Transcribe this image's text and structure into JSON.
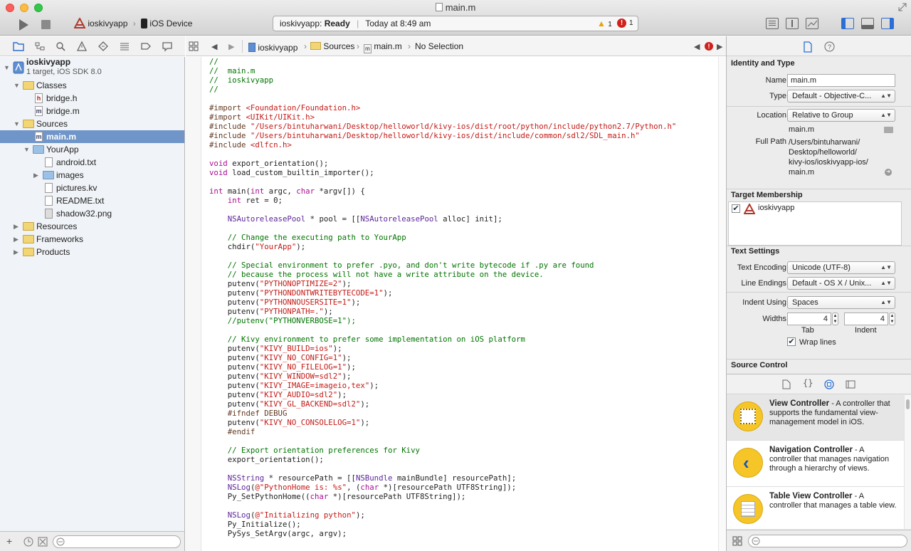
{
  "window": {
    "title": "main.m"
  },
  "toolbar": {
    "scheme": "ioskivyapp",
    "destination": "iOS Device",
    "status_app": "ioskivyapp:",
    "status_state": "Ready",
    "status_time": "Today at 8:49 am",
    "warning_count": "1",
    "error_count": "1"
  },
  "navigator": {
    "project_name": "ioskivyapp",
    "project_subtitle": "1 target, iOS SDK 8.0",
    "rows": [
      {
        "label": "Classes"
      },
      {
        "label": "bridge.h"
      },
      {
        "label": "bridge.m"
      },
      {
        "label": "Sources"
      },
      {
        "label": "main.m"
      },
      {
        "label": "YourApp"
      },
      {
        "label": "android.txt"
      },
      {
        "label": "images"
      },
      {
        "label": "pictures.kv"
      },
      {
        "label": "README.txt"
      },
      {
        "label": "shadow32.png"
      },
      {
        "label": "Resources"
      },
      {
        "label": "Frameworks"
      },
      {
        "label": "Products"
      }
    ]
  },
  "jumpbar": {
    "project": "ioskivyapp",
    "group": "Sources",
    "file": "main.m",
    "selection": "No Selection"
  },
  "code_lines": [
    "//",
    "//  main.m",
    "//  ioskivyapp",
    "//",
    "",
    "#import <Foundation/Foundation.h>",
    "#import <UIKit/UIKit.h>",
    "#include \"/Users/bintuharwani/Desktop/helloworld/kivy-ios/dist/root/python/include/python2.7/Python.h\"",
    "#include \"/Users/bintuharwani/Desktop/helloworld/kivy-ios/dist/include/common/sdl2/SDL_main.h\"",
    "#include <dlfcn.h>",
    "",
    "void export_orientation();",
    "void load_custom_builtin_importer();",
    "",
    "int main(int argc, char *argv[]) {",
    "    int ret = 0;",
    "",
    "    NSAutoreleasePool * pool = [[NSAutoreleasePool alloc] init];",
    "",
    "    // Change the executing path to YourApp",
    "    chdir(\"YourApp\");",
    "",
    "    // Special environment to prefer .pyo, and don't write bytecode if .py are found",
    "    // because the process will not have a write attribute on the device.",
    "    putenv(\"PYTHONOPTIMIZE=2\");",
    "    putenv(\"PYTHONDONTWRITEBYTECODE=1\");",
    "    putenv(\"PYTHONNOUSERSITE=1\");",
    "    putenv(\"PYTHONPATH=.\");",
    "    //putenv(\"PYTHONVERBOSE=1\");",
    "",
    "    // Kivy environment to prefer some implementation on iOS platform",
    "    putenv(\"KIVY_BUILD=ios\");",
    "    putenv(\"KIVY_NO_CONFIG=1\");",
    "    putenv(\"KIVY_NO_FILELOG=1\");",
    "    putenv(\"KIVY_WINDOW=sdl2\");",
    "    putenv(\"KIVY_IMAGE=imageio,tex\");",
    "    putenv(\"KIVY_AUDIO=sdl2\");",
    "    putenv(\"KIVY_GL_BACKEND=sdl2\");",
    "    #ifndef DEBUG",
    "    putenv(\"KIVY_NO_CONSOLELOG=1\");",
    "    #endif",
    "",
    "    // Export orientation preferences for Kivy",
    "    export_orientation();",
    "",
    "    NSString * resourcePath = [[NSBundle mainBundle] resourcePath];",
    "    NSLog(@\"PythonHome is: %s\", (char *)[resourcePath UTF8String]);",
    "    Py_SetPythonHome((char *)[resourcePath UTF8String]);",
    "",
    "    NSLog(@\"Initializing python\");",
    "    Py_Initialize();",
    "    PySys_SetArgv(argc, argv);"
  ],
  "inspector": {
    "identity_header": "Identity and Type",
    "name_label": "Name",
    "name_value": "main.m",
    "type_label": "Type",
    "type_value": "Default - Objective-C...",
    "location_label": "Location",
    "location_value": "Relative to Group",
    "location_file": "main.m",
    "fullpath_label": "Full Path",
    "fullpath_lines": [
      "/Users/bintuharwani/",
      "Desktop/helloworld/",
      "kivy-ios/ioskivyapp-ios/",
      "main.m"
    ],
    "target_header": "Target Membership",
    "target_name": "ioskivyapp",
    "text_header": "Text Settings",
    "encoding_label": "Text Encoding",
    "encoding_value": "Unicode (UTF-8)",
    "endings_label": "Line Endings",
    "endings_value": "Default - OS X / Unix...",
    "indent_label": "Indent Using",
    "indent_value": "Spaces",
    "widths_label": "Widths",
    "tab_value": "4",
    "indent_width_value": "4",
    "tab_caption": "Tab",
    "indent_caption": "Indent",
    "wrap_label": "Wrap lines",
    "source_header": "Source Control"
  },
  "library": [
    {
      "title": "View Controller",
      "desc": " - A controller that supports the fundamental view-management model in iOS."
    },
    {
      "title": "Navigation Controller",
      "desc": " - A controller that manages navigation through a hierarchy of views."
    },
    {
      "title": "Table View Controller",
      "desc": " - A controller that manages a table view."
    }
  ]
}
